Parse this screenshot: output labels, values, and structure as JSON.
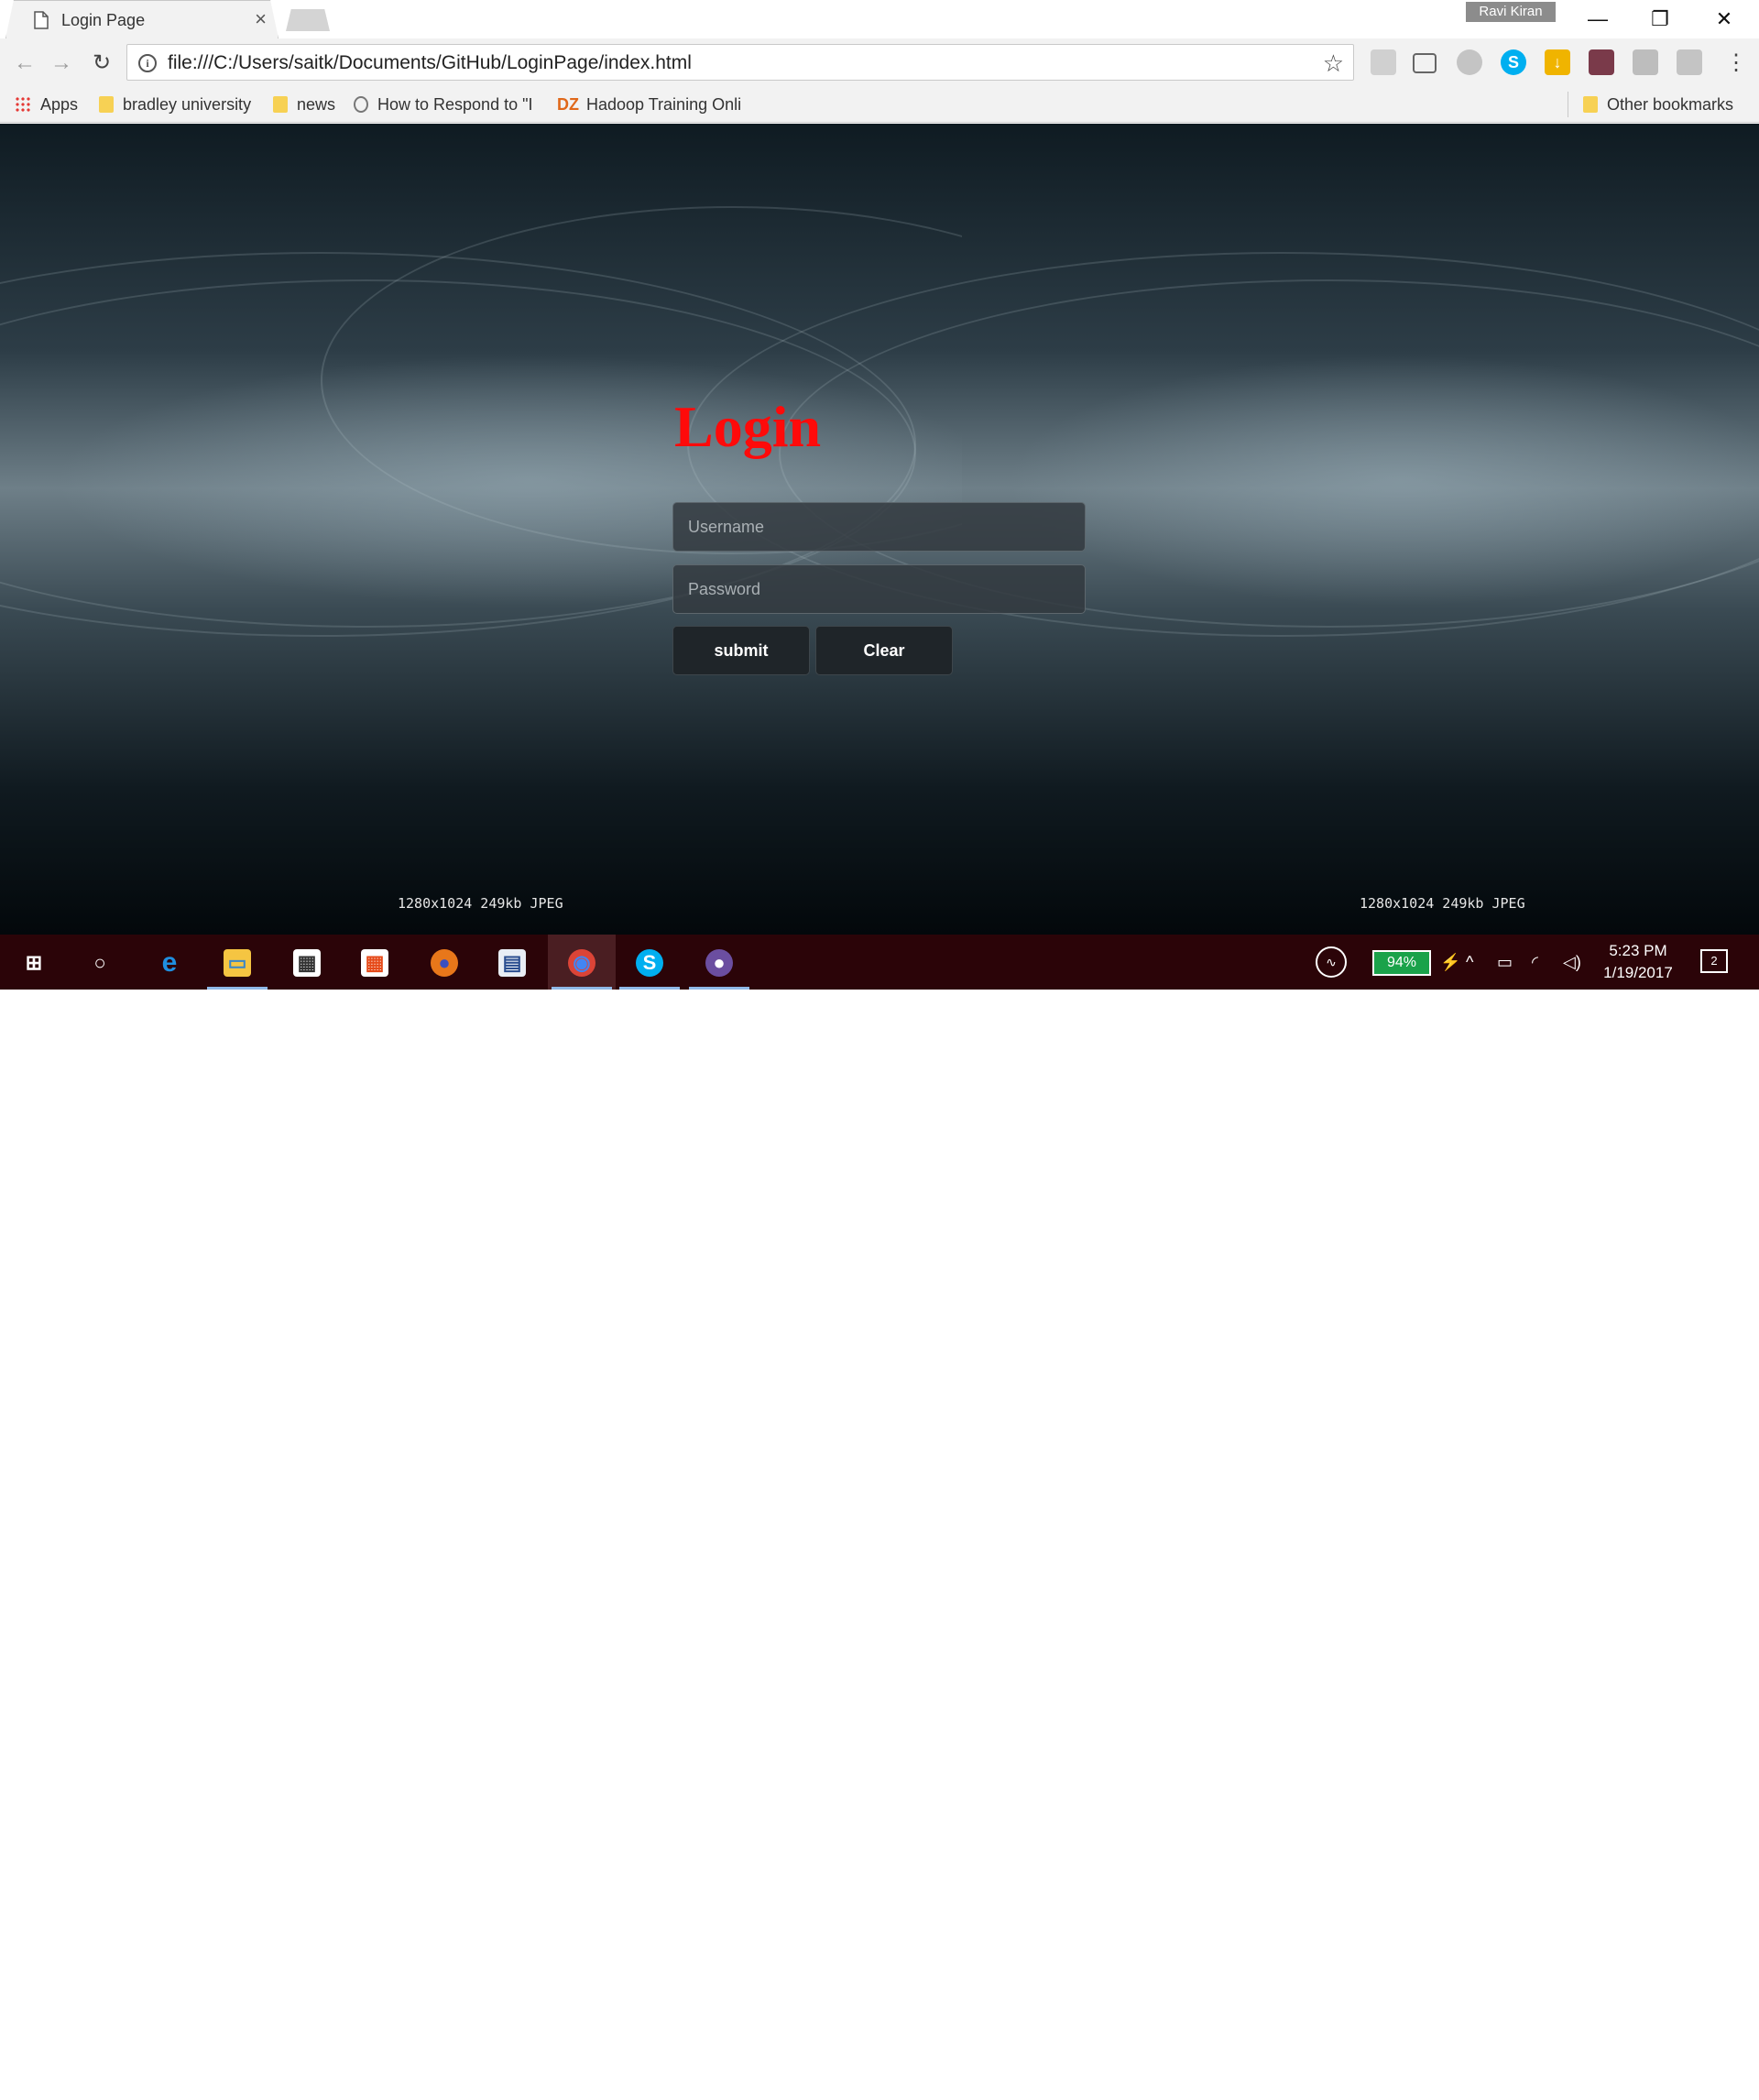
{
  "browser": {
    "tab": {
      "title": "Login Page",
      "close_glyph": "×"
    },
    "user_badge": "Ravi Kiran",
    "window_controls": {
      "minimize": "—",
      "restore": "❐",
      "close": "✕"
    },
    "nav": {
      "back": "←",
      "forward": "→",
      "reload": "↻"
    },
    "address": {
      "url": "file:///C:/Users/saitk/Documents/GitHub/LoginPage/index.html",
      "info_glyph": "i",
      "star_glyph": "☆"
    },
    "extensions": [
      {
        "name": "cube-extension-icon",
        "color": "#b0b0b0"
      },
      {
        "name": "cast-icon",
        "color": "#666666"
      },
      {
        "name": "circle-extension-icon",
        "color": "#b8b8b8"
      },
      {
        "name": "skype-icon",
        "glyph": "S",
        "color": "#00aff0"
      },
      {
        "name": "download-extension-icon",
        "glyph": "↓",
        "color": "#f0b400"
      },
      {
        "name": "picture-extension-icon",
        "color": "#7a3a4a"
      },
      {
        "name": "people-extension-icon",
        "color": "#b0b0b0"
      },
      {
        "name": "pdf-extension-icon",
        "color": "#b0b0b0"
      }
    ],
    "menu_glyph": "⋮",
    "bookmarks": {
      "items": [
        {
          "label": "Apps",
          "icon": "apps-grid-icon"
        },
        {
          "label": "bradley university",
          "icon": "folder-icon"
        },
        {
          "label": "news",
          "icon": "folder-icon"
        },
        {
          "label": "How to Respond to \"I",
          "icon": "link-icon"
        },
        {
          "label": "Hadoop Training Onli",
          "icon": "dz-icon",
          "prefix": "DZ"
        }
      ],
      "other": "Other bookmarks"
    }
  },
  "page": {
    "heading": "Login",
    "username_placeholder": "Username",
    "password_placeholder": "Password",
    "submit_label": "submit",
    "clear_label": "Clear",
    "image_info_left": "1280x1024 249kb JPEG",
    "image_info_right": "1280x1024 249kb JPEG",
    "heading_color": "#ff0a0a"
  },
  "taskbar": {
    "apps": [
      {
        "name": "start-button",
        "glyph": "⊞"
      },
      {
        "name": "cortana-button",
        "glyph": "○"
      },
      {
        "name": "edge-icon",
        "glyph": "e"
      },
      {
        "name": "file-explorer-icon",
        "glyph": "▭"
      },
      {
        "name": "store-icon",
        "glyph": "▦"
      },
      {
        "name": "apps-tile-icon",
        "glyph": "▦"
      },
      {
        "name": "firefox-icon",
        "glyph": "●"
      },
      {
        "name": "remote-desktop-icon",
        "glyph": "▤"
      },
      {
        "name": "chrome-icon",
        "glyph": "◉"
      },
      {
        "name": "skype-icon",
        "glyph": "S"
      },
      {
        "name": "github-icon",
        "glyph": "●"
      }
    ],
    "battery": "94%",
    "time": "5:23 PM",
    "date": "1/19/2017",
    "notifications": "2"
  }
}
